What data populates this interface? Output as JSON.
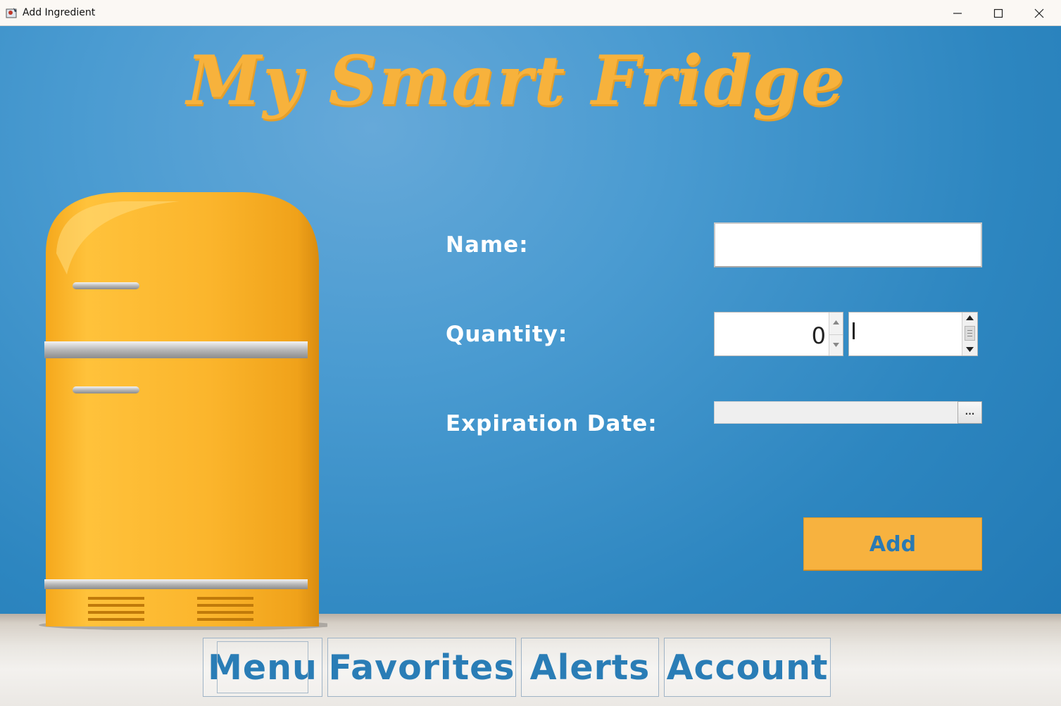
{
  "window": {
    "title": "Add Ingredient",
    "icons": {
      "app": "app-icon",
      "minimize": "minimize-icon",
      "maximize": "maximize-icon",
      "close": "close-icon"
    }
  },
  "header": {
    "app_title": "My Smart Fridge"
  },
  "form": {
    "name_label": "Name:",
    "name_value": "",
    "quantity_label": "Quantity:",
    "quantity_value": "0",
    "unit_value": "",
    "expiration_label": "Expiration Date:",
    "expiration_value": "",
    "date_picker_button": "...",
    "add_button": "Add"
  },
  "nav": {
    "items": [
      {
        "label": "Menu"
      },
      {
        "label": "Favorites"
      },
      {
        "label": "Alerts"
      },
      {
        "label": "Account"
      }
    ]
  },
  "colors": {
    "accent": "#f7b23f",
    "brand_blue": "#2a7db6",
    "background": "#2f8bc4"
  }
}
